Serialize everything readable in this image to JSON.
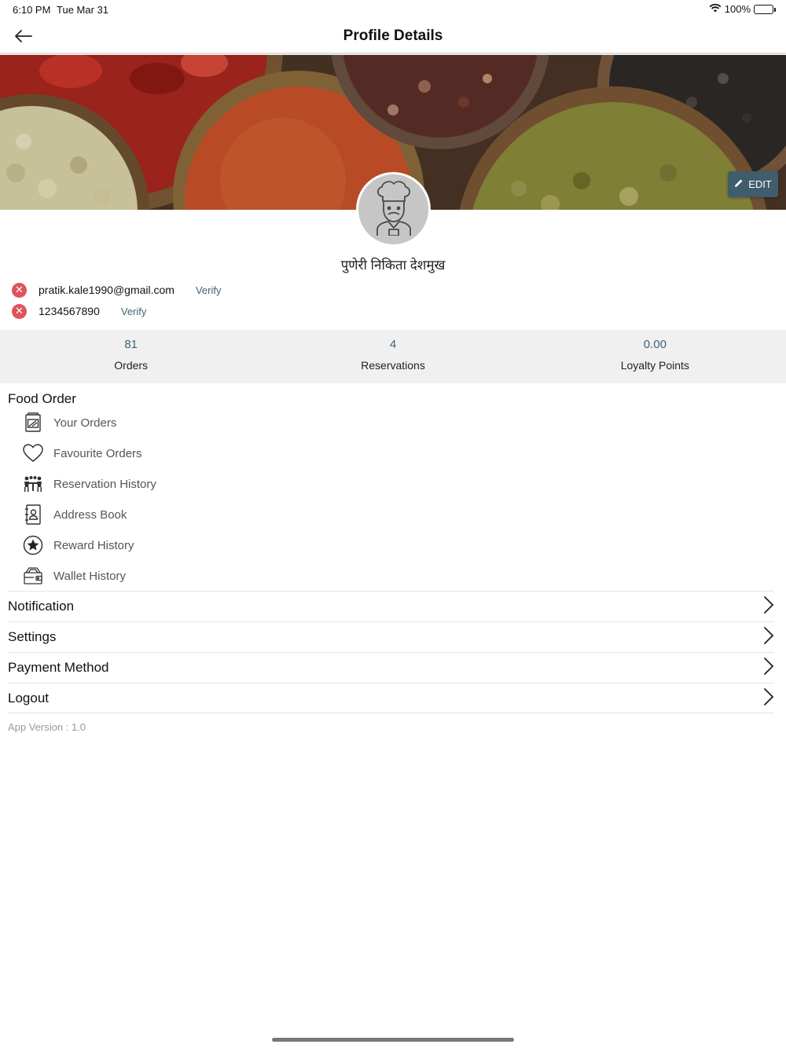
{
  "status_bar": {
    "time": "6:10 PM",
    "date": "Tue Mar 31",
    "battery": "100%"
  },
  "header": {
    "title": "Profile Details"
  },
  "cover": {
    "edit_label": "EDIT"
  },
  "profile": {
    "name": "पुणेरी निकिता देशमुख",
    "email": "pratik.kale1990@gmail.com",
    "phone": "1234567890",
    "verify_label": "Verify"
  },
  "stats": [
    {
      "value": "81",
      "label": "Orders"
    },
    {
      "value": "4",
      "label": "Reservations"
    },
    {
      "value": "0.00",
      "label": "Loyalty Points"
    }
  ],
  "food_order": {
    "title": "Food Order",
    "items": [
      {
        "label": "Your Orders",
        "icon": "orders-icon"
      },
      {
        "label": "Favourite Orders",
        "icon": "heart-icon"
      },
      {
        "label": "Reservation History",
        "icon": "reservation-icon"
      },
      {
        "label": "Address Book",
        "icon": "address-book-icon"
      },
      {
        "label": "Reward History",
        "icon": "star-icon"
      },
      {
        "label": "Wallet History",
        "icon": "wallet-icon"
      }
    ]
  },
  "links": [
    {
      "label": "Notification"
    },
    {
      "label": "Settings"
    },
    {
      "label": "Payment Method"
    },
    {
      "label": "Logout"
    }
  ],
  "footer": {
    "version": "App Version : 1.0"
  },
  "colors": {
    "accent": "#3f6277",
    "edit_button": "#3f5d6d",
    "error": "#e0535c",
    "stats_bg": "#f0f0f0"
  }
}
